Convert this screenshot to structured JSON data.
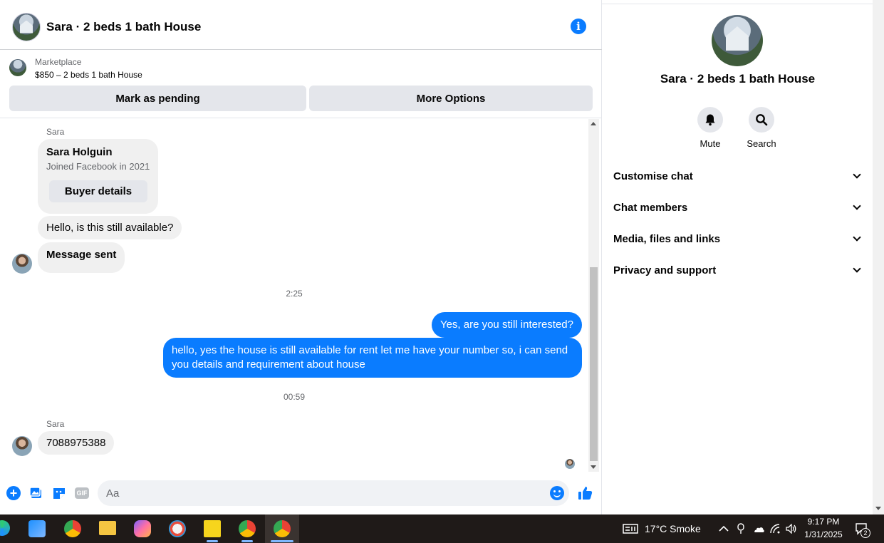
{
  "header": {
    "title": "Sara · 2 beds 1 bath House",
    "info_icon": "i"
  },
  "marketplace": {
    "label": "Marketplace",
    "item": "$850 – 2 beds 1 bath House",
    "mark_pending_label": "Mark as pending",
    "more_options_label": "More Options"
  },
  "messages": {
    "sender_top": "Sara",
    "card": {
      "name": "Sara Holguin",
      "joined": "Joined Facebook in 2021",
      "button": "Buyer details"
    },
    "msg_available": "Hello, is this still available?",
    "msg_sent": "Message sent",
    "time_1": "2:25",
    "out_1": "Yes, are you still interested?",
    "out_2": "hello, yes the house is still available for rent  let me have your number so, i can send you details and requirement about house",
    "time_2": "00:59",
    "sender_bottom": "Sara",
    "msg_number": "7088975388"
  },
  "composer": {
    "placeholder": "Aa",
    "gif_label": "GIF"
  },
  "side": {
    "title": "Sara · 2 beds 1 bath House",
    "mute_label": "Mute",
    "search_label": "Search",
    "sections": [
      "Customise chat",
      "Chat members",
      "Media, files and links",
      "Privacy and support"
    ]
  },
  "taskbar": {
    "weather": "17°C  Smoke",
    "time": "9:17 PM",
    "date": "1/31/2025",
    "notifications": "2"
  },
  "colors": {
    "accent": "#0a7cff",
    "bubble_in": "#f0f0f0",
    "button_gray": "#e4e6eb"
  }
}
